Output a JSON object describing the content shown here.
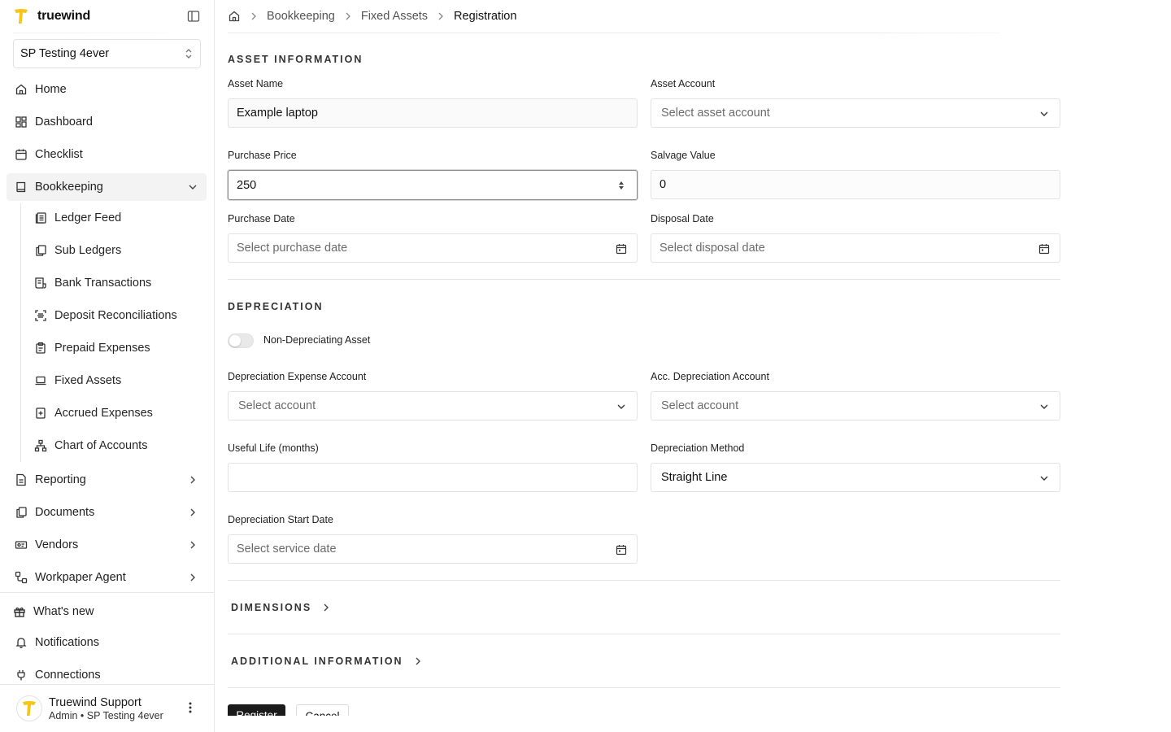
{
  "app": {
    "name": "truewind"
  },
  "org": {
    "selected": "SP Testing 4ever"
  },
  "sidebar": {
    "items": [
      {
        "label": "Home",
        "icon": "home-icon"
      },
      {
        "label": "Dashboard",
        "icon": "dashboard-icon"
      },
      {
        "label": "Checklist",
        "icon": "calendar-icon"
      },
      {
        "label": "Bookkeeping",
        "icon": "book-icon"
      },
      {
        "label": "Reporting",
        "icon": "report-icon"
      },
      {
        "label": "Documents",
        "icon": "documents-icon"
      },
      {
        "label": "Vendors",
        "icon": "vendors-icon"
      },
      {
        "label": "Workpaper Agent",
        "icon": "workflow-icon"
      }
    ],
    "bookkeeping_sub": [
      {
        "label": "Ledger Feed",
        "icon": "ledger-icon"
      },
      {
        "label": "Sub Ledgers",
        "icon": "copy-icon"
      },
      {
        "label": "Bank Transactions",
        "icon": "receipt-icon"
      },
      {
        "label": "Deposit Reconciliations",
        "icon": "scan-icon"
      },
      {
        "label": "Prepaid Expenses",
        "icon": "clipboard-icon"
      },
      {
        "label": "Fixed Assets",
        "icon": "laptop-icon"
      },
      {
        "label": "Accrued Expenses",
        "icon": "plus-square-icon"
      },
      {
        "label": "Chart of Accounts",
        "icon": "hierarchy-icon"
      }
    ],
    "bottom": [
      {
        "label": "What's new",
        "icon": "gift-icon"
      },
      {
        "label": "Notifications",
        "icon": "bell-icon"
      },
      {
        "label": "Connections",
        "icon": "plug-icon"
      }
    ]
  },
  "user": {
    "name": "Truewind Support",
    "role": "Admin • SP Testing 4ever"
  },
  "breadcrumb": [
    "Bookkeeping",
    "Fixed Assets",
    "Registration"
  ],
  "asset_info": {
    "title": "ASSET INFORMATION",
    "asset_name_label": "Asset Name",
    "asset_name_value": "Example laptop",
    "asset_account_label": "Asset Account",
    "asset_account_placeholder": "Select asset account",
    "purchase_price_label": "Purchase Price",
    "purchase_price_value": "250",
    "salvage_value_label": "Salvage Value",
    "salvage_value_value": "0",
    "purchase_date_label": "Purchase Date",
    "purchase_date_placeholder": "Select purchase date",
    "disposal_date_label": "Disposal Date",
    "disposal_date_placeholder": "Select disposal date"
  },
  "depreciation": {
    "title": "DEPRECIATION",
    "toggle_label": "Non-Depreciating Asset",
    "toggle_on": false,
    "expense_account_label": "Depreciation Expense Account",
    "expense_account_placeholder": "Select account",
    "acc_account_label": "Acc. Depreciation Account",
    "acc_account_placeholder": "Select account",
    "useful_life_label": "Useful Life (months)",
    "useful_life_value": "",
    "method_label": "Depreciation Method",
    "method_value": "Straight Line",
    "start_date_label": "Depreciation Start Date",
    "start_date_placeholder": "Select service date"
  },
  "collapsibles": {
    "dimensions": "DIMENSIONS",
    "additional": "ADDITIONAL INFORMATION"
  },
  "actions": {
    "register": "Register",
    "cancel": "Cancel"
  },
  "colors": {
    "brand_yellow": "#f5c518",
    "primary_button": "#1b1b1b"
  }
}
